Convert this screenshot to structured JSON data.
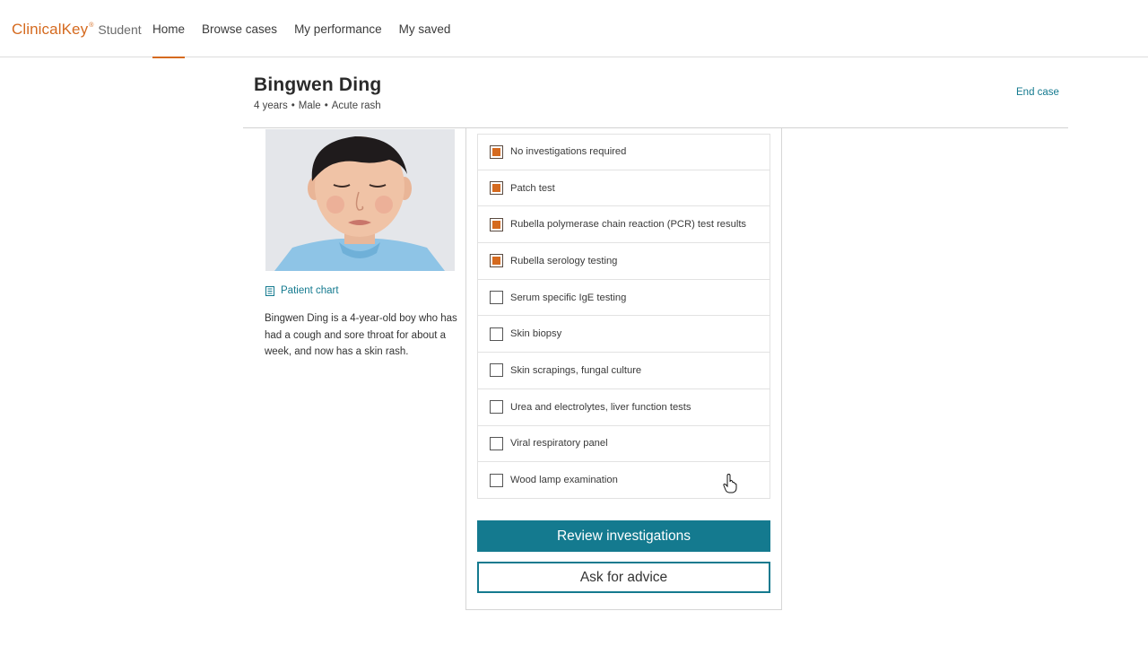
{
  "brand": {
    "main": "ClinicalKey",
    "reg": "®",
    "sub": "Student",
    "color": "#d56a1f"
  },
  "nav": {
    "items": [
      {
        "label": "Home",
        "active": true
      },
      {
        "label": "Browse cases"
      },
      {
        "label": "My performance"
      },
      {
        "label": "My saved"
      }
    ]
  },
  "patient": {
    "name": "Bingwen Ding",
    "age": "4 years",
    "sex": "Male",
    "complaint": "Acute rash",
    "separator": "•",
    "chart_link": "Patient chart",
    "description": "Bingwen Ding is a 4-year-old boy who has had a cough and sore throat for about a week, and now has a skin rash."
  },
  "header": {
    "end_case": "End case"
  },
  "investigations": [
    {
      "label": "No investigations required",
      "checked": true
    },
    {
      "label": "Patch test",
      "checked": true
    },
    {
      "label": "Rubella polymerase chain reaction (PCR) test results",
      "checked": true
    },
    {
      "label": "Rubella serology testing",
      "checked": true
    },
    {
      "label": "Serum specific IgE testing",
      "checked": false
    },
    {
      "label": "Skin biopsy",
      "checked": false
    },
    {
      "label": "Skin scrapings, fungal culture",
      "checked": false
    },
    {
      "label": "Urea and electrolytes, liver function tests",
      "checked": false
    },
    {
      "label": "Viral respiratory panel",
      "checked": false
    },
    {
      "label": "Wood lamp examination",
      "checked": false
    }
  ],
  "actions": {
    "review_label": "Review investigations",
    "advice_label": "Ask for advice"
  },
  "colors": {
    "accent": "#147a8f",
    "brand": "#d56a1f"
  },
  "icons": {
    "chart": "document-icon",
    "cursor": "hand-pointer-icon"
  }
}
